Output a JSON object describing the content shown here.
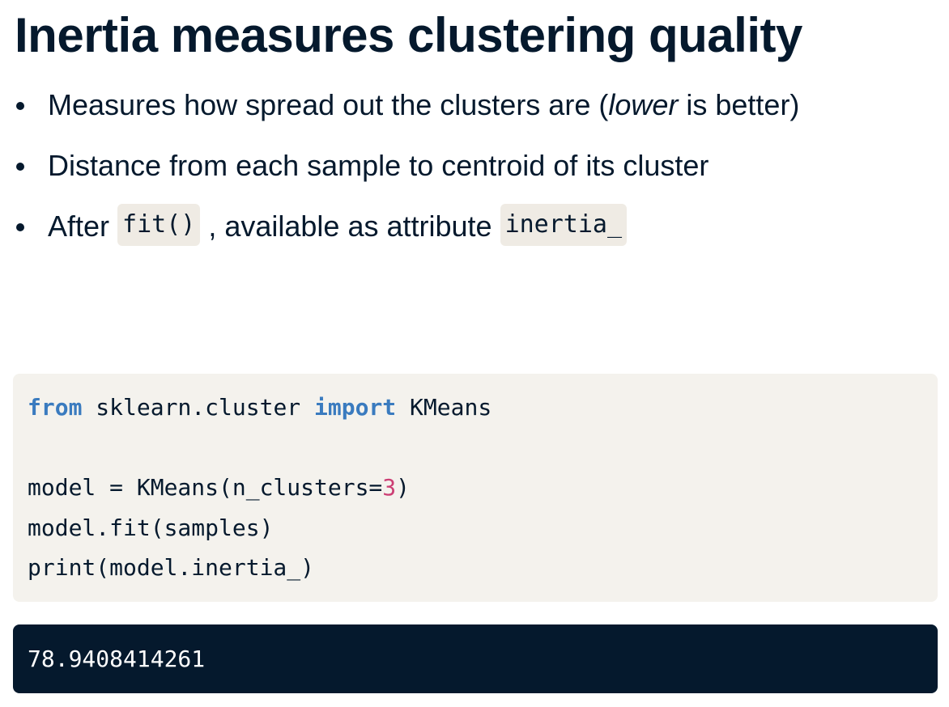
{
  "title": "Inertia measures clustering quality",
  "bullets": [
    {
      "text_before": "Measures how spread out the clusters are (",
      "emphasis": "lower",
      "text_after": " is better)"
    },
    {
      "text": "Distance from each sample to centroid of its cluster"
    },
    {
      "text_before": "After",
      "code_1": "fit()",
      "text_middle": ", available as attribute",
      "code_2": "inertia_"
    }
  ],
  "code": {
    "line1": {
      "kw1": "from",
      "module": " sklearn.cluster ",
      "kw2": "import",
      "name": " KMeans"
    },
    "line3": {
      "before": "model = KMeans(n_clusters=",
      "number": "3",
      "after": ")"
    },
    "line4": "model.fit(samples)",
    "line5": "print(model.inertia_)"
  },
  "output": "78.9408414261",
  "colors": {
    "text": "#05192d",
    "keyword": "#3a7bbf",
    "number": "#cc3f74",
    "code_background": "#f4f2ed",
    "inline_code_background": "#efebe4",
    "output_background": "#05192d"
  }
}
